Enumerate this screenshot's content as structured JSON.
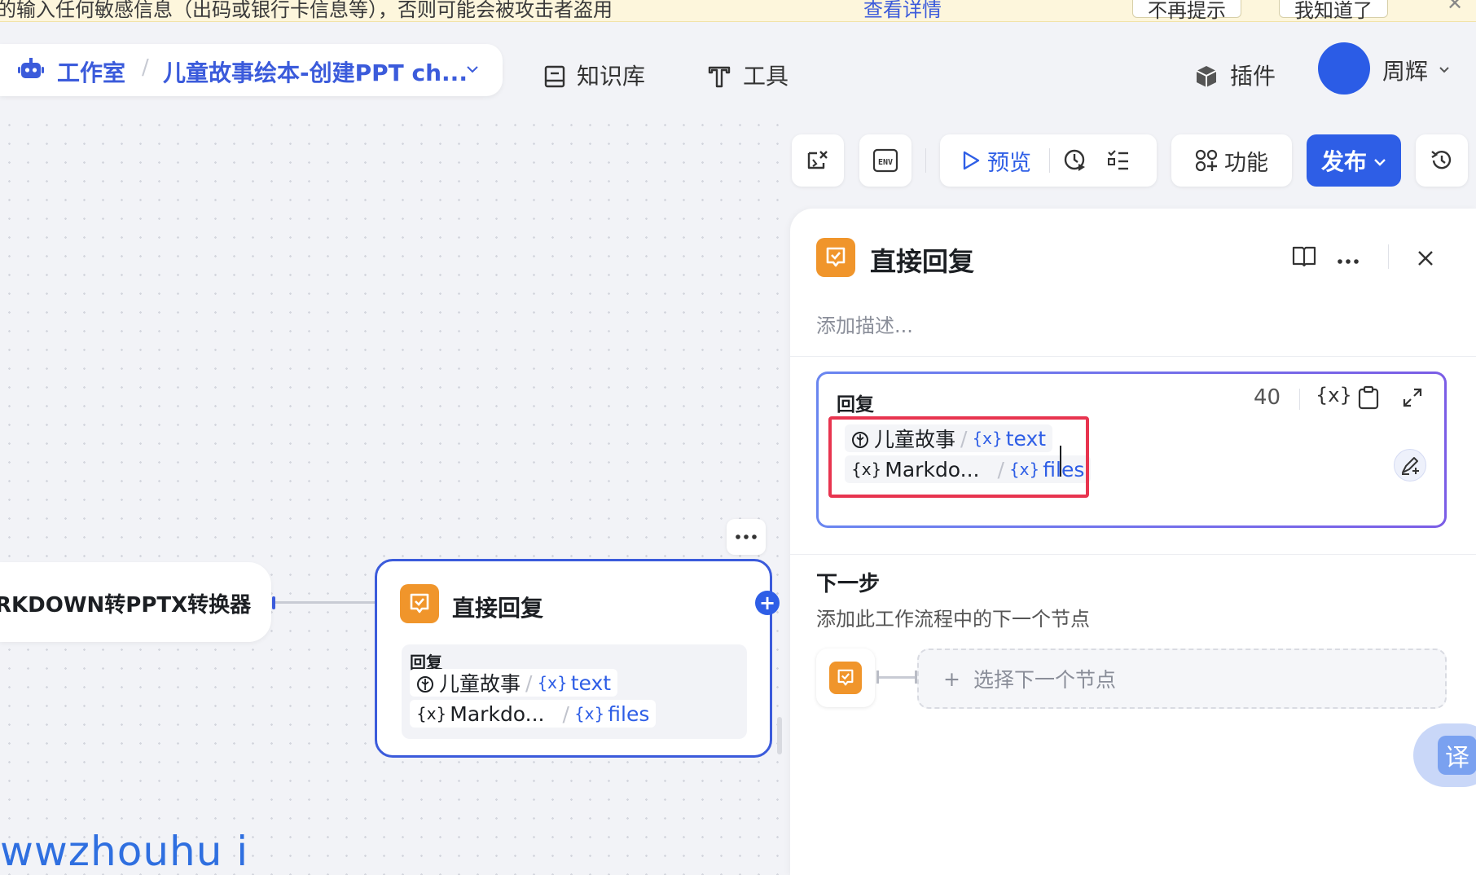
{
  "notice": {
    "text": "的输入任何敏感信息（出码或银行卡信息等），否则可能会被攻击者盗用",
    "link": "查看详情",
    "btn_no_remind": "不再提示",
    "btn_got_it": "我知道了"
  },
  "header": {
    "studio": "工作室",
    "project": "儿童故事绘本-创建PPT ch...",
    "nav": [
      {
        "label": "知识库",
        "icon": "book-icon"
      },
      {
        "label": "工具",
        "icon": "tool-icon"
      }
    ],
    "plugin": "插件",
    "user": "周辉"
  },
  "toolbar": {
    "preview": "预览",
    "functions": "功能",
    "publish": "发布",
    "env": "ENV"
  },
  "canvas": {
    "md_node_title": "RKDOWN转PPTX转换器",
    "reply_node": {
      "title": "直接回复",
      "label": "回复",
      "chip1_source": "儿童故事",
      "chip1_var": "text",
      "chip2_source": "Markdo...",
      "chip2_var": "files"
    },
    "watermark": "wwzhouhu i"
  },
  "panel": {
    "title": "直接回复",
    "description_placeholder": "添加描述...",
    "reply": {
      "label": "回复",
      "count": "40",
      "chip1_source": "儿童故事",
      "chip1_var": "text",
      "chip2_source": "Markdo...",
      "chip2_var": "files"
    },
    "next": {
      "title": "下一步",
      "desc": "添加此工作流程中的下一个节点",
      "select_placeholder": "选择下一个节点"
    },
    "translate": "译"
  },
  "colors": {
    "accent": "#2e5ee6",
    "node_orange": "#f0952b",
    "highlight_red": "#e8344f"
  }
}
